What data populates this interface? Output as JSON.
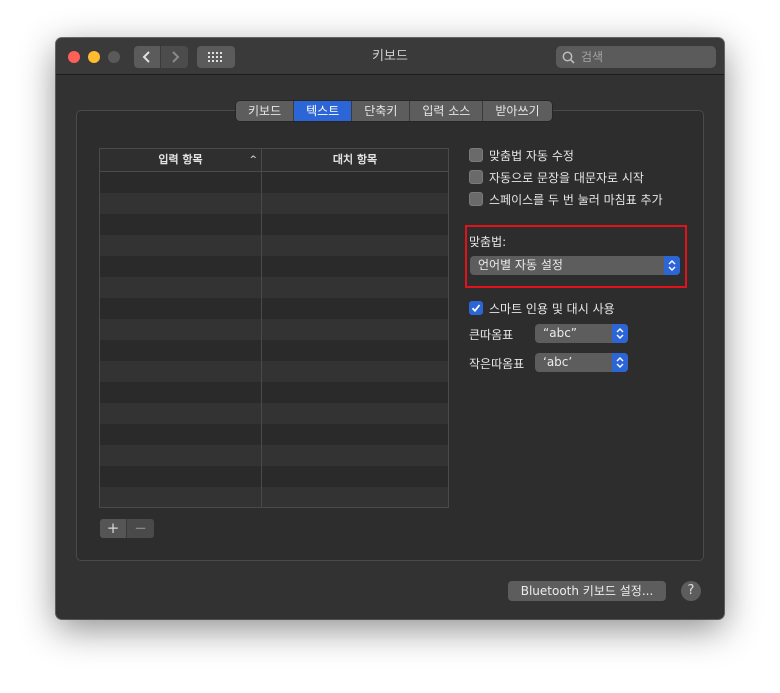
{
  "window": {
    "title": "키보드"
  },
  "search": {
    "placeholder": "검색",
    "icon": "magnifying-glass"
  },
  "tabs": [
    {
      "label": "키보드",
      "active": false
    },
    {
      "label": "텍스트",
      "active": true
    },
    {
      "label": "단축키",
      "active": false
    },
    {
      "label": "입력 소스",
      "active": false
    },
    {
      "label": "받아쓰기",
      "active": false
    }
  ],
  "table": {
    "columns": [
      "입력 항목",
      "대치 항목"
    ],
    "sort_indicator": "^",
    "rows": []
  },
  "table_controls": {
    "add": "+",
    "remove": "−"
  },
  "options": {
    "auto_correct": {
      "label": "맞춤법 자동 수정",
      "checked": false
    },
    "auto_capitalize": {
      "label": "자동으로 문장을 대문자로 시작",
      "checked": false
    },
    "double_space_period": {
      "label": "스페이스를 두 번 눌러 마침표 추가",
      "checked": false
    }
  },
  "spelling": {
    "label": "맞춤법:",
    "value": "언어별 자동 설정"
  },
  "smart_quotes": {
    "label": "스마트 인용 및 대시 사용",
    "checked": true,
    "double_label": "큰따옴표",
    "double_value": "“abc”",
    "single_label": "작은따옴표",
    "single_value": "‘abc’"
  },
  "footer": {
    "bluetooth_button": "Bluetooth 키보드 설정...",
    "help": "?"
  },
  "colors": {
    "accent": "#2c66d6",
    "highlight_border": "#e0131a",
    "window_bg": "#323232"
  }
}
